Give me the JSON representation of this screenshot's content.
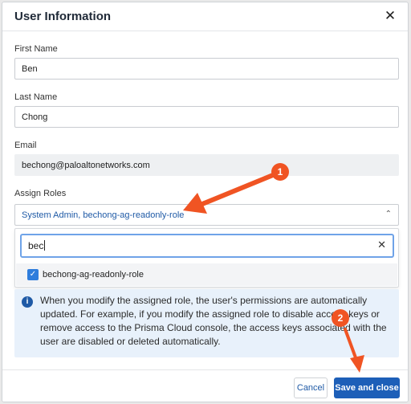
{
  "dialog": {
    "title": "User Information",
    "close_icon": "close-icon"
  },
  "form": {
    "first_name": {
      "label": "First Name",
      "value": "Ben"
    },
    "last_name": {
      "label": "Last Name",
      "value": "Chong"
    },
    "email": {
      "label": "Email",
      "value": "bechong@paloaltonetworks.com"
    },
    "assign_roles": {
      "label": "Assign Roles",
      "selected": "System Admin, bechong-ag-readonly-role",
      "search_value": "bec",
      "options": [
        {
          "label": "bechong-ag-readonly-role",
          "checked": true
        }
      ]
    }
  },
  "info": {
    "icon": "info-icon",
    "text": "When you modify the assigned role, the user's permissions are automatically updated. For example, if you modify the assigned role to disable access keys or remove access to the Prisma Cloud console, the access keys associated with the user are disabled or deleted automatically."
  },
  "footer": {
    "cancel_label": "Cancel",
    "save_label": "Save and close"
  },
  "annotations": {
    "badge_1": "1",
    "badge_2": "2",
    "color": "#f05423"
  },
  "colors": {
    "primary": "#1d5fb8",
    "link": "#1f5aa6",
    "info_bg": "#e8f1fb",
    "focus": "#6fa3e8"
  }
}
